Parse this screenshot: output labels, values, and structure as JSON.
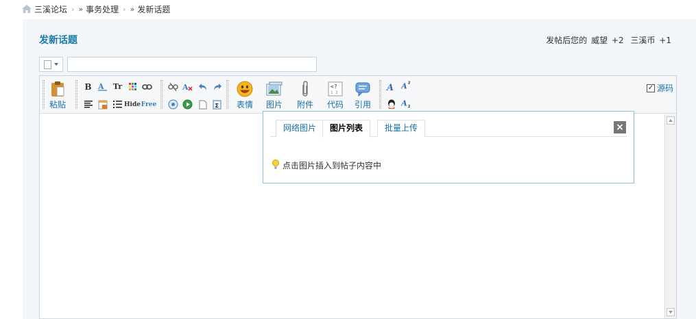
{
  "breadcrumb": {
    "items": [
      "三溪论坛",
      "事务处理",
      "发新话题"
    ],
    "separator": "›",
    "raquo": "»"
  },
  "header": {
    "title": "发新话题",
    "reward_prefix": "发帖后您的",
    "reward_items": [
      {
        "label": "威望",
        "value": "+2"
      },
      {
        "label": "三溪币",
        "value": "+1"
      }
    ]
  },
  "subject": {
    "value": "",
    "placeholder": ""
  },
  "toolbar": {
    "paste_label": "粘贴",
    "emoji_label": "表情",
    "image_label": "图片",
    "attach_label": "附件",
    "code_label": "代码",
    "quote_label": "引用",
    "source_label": "源码",
    "bold_glyph": "B",
    "font_glyph": "Tr",
    "hide_glyph": "Hide",
    "free_glyph": "Free"
  },
  "image_popup": {
    "tabs": [
      "网络图片",
      "图片列表",
      "批量上传"
    ],
    "active_tab": "图片列表",
    "close_glyph": "×",
    "hint": "点击图片插入到帖子内容中"
  },
  "colors": {
    "accent": "#1a7aa8",
    "panel_bg": "#f2f5f9",
    "border": "#c9d3dc"
  }
}
